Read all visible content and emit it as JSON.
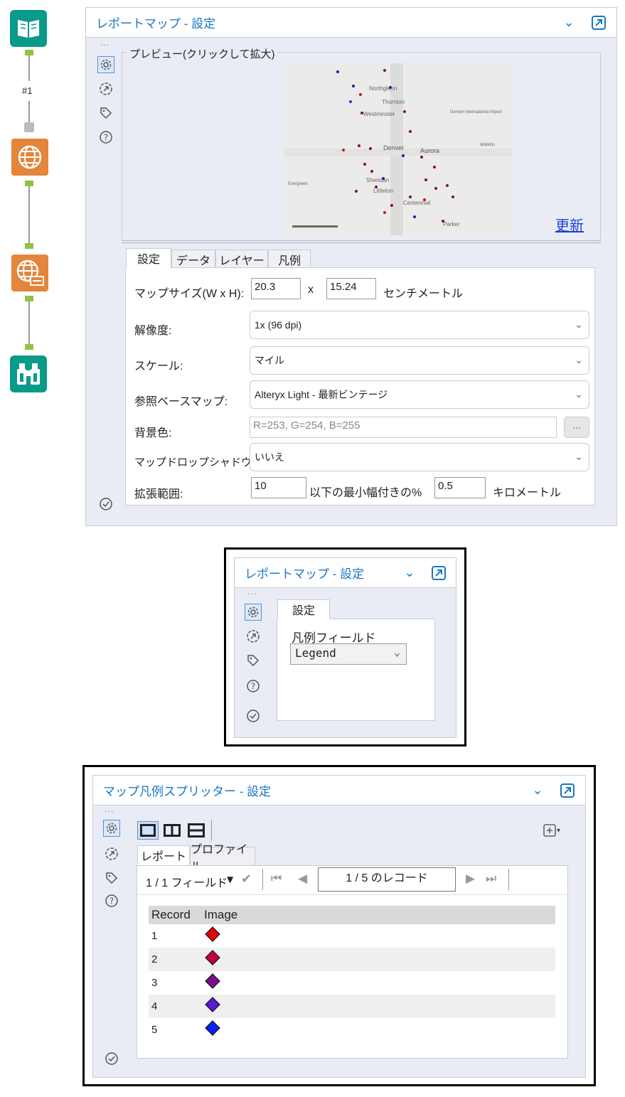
{
  "workflow": {
    "connection_label": "#1"
  },
  "panel1": {
    "title": "レポートマップ - 設定",
    "preview_label": "プレビュー(クリックして拡大)",
    "refresh_link": "更新",
    "map_labels": [
      "Northglenn",
      "Thornton",
      "Westminster",
      "Denver",
      "Aurora",
      "Sheridan",
      "Littleton",
      "Centennial",
      "Parker",
      "Denver International Airport",
      "Watkins",
      "Evergreen"
    ],
    "tabs": [
      "設定",
      "データ",
      "レイヤー",
      "凡例"
    ],
    "fields": {
      "map_size_label": "マップサイズ(W x H):",
      "width_value": "20.3",
      "x_sep": "x",
      "height_value": "15.24",
      "unit": "センチメートル",
      "resolution_label": "解像度:",
      "resolution_value": "1x (96 dpi)",
      "scale_label": "スケール:",
      "scale_value": "マイル",
      "basemap_label": "参照ベースマップ:",
      "basemap_value": "Alteryx Light - 最新ビンテージ",
      "bg_label": "背景色:",
      "bg_value": "R=253, G=254, B=255",
      "bg_button": "...",
      "shadow_label": "マップドロップシャドウ:",
      "shadow_value": "いいえ",
      "expand_label": "拡張範囲:",
      "expand_value": "10",
      "expand_mid": "以下の最小幅付きの%",
      "expand_min": "0.5",
      "expand_unit": "キロメートル"
    }
  },
  "panel2": {
    "title": "レポートマップ - 設定",
    "tab": "設定",
    "legend_field_label": "凡例フィールド",
    "legend_field_value": "Legend"
  },
  "panel3": {
    "title": "マップ凡例スプリッター - 設定",
    "tabs": [
      "レポート",
      "プロファイル"
    ],
    "field_selector": "1 / 1 フィールド",
    "record_nav": "1 / 5 のレコード",
    "columns": [
      "Record",
      "Image"
    ],
    "rows": [
      {
        "record": "1",
        "color": "#e00000"
      },
      {
        "record": "2",
        "color": "#c4003c"
      },
      {
        "record": "3",
        "color": "#7d0f8a"
      },
      {
        "record": "4",
        "color": "#5a1ad6"
      },
      {
        "record": "5",
        "color": "#0a22f0"
      }
    ]
  },
  "colors": {
    "accent": "#1976c5",
    "link": "#1b3fd8",
    "connector": "#8fc43f",
    "tool_orange": "#e3853a",
    "tool_teal": "#0a9a8a"
  }
}
